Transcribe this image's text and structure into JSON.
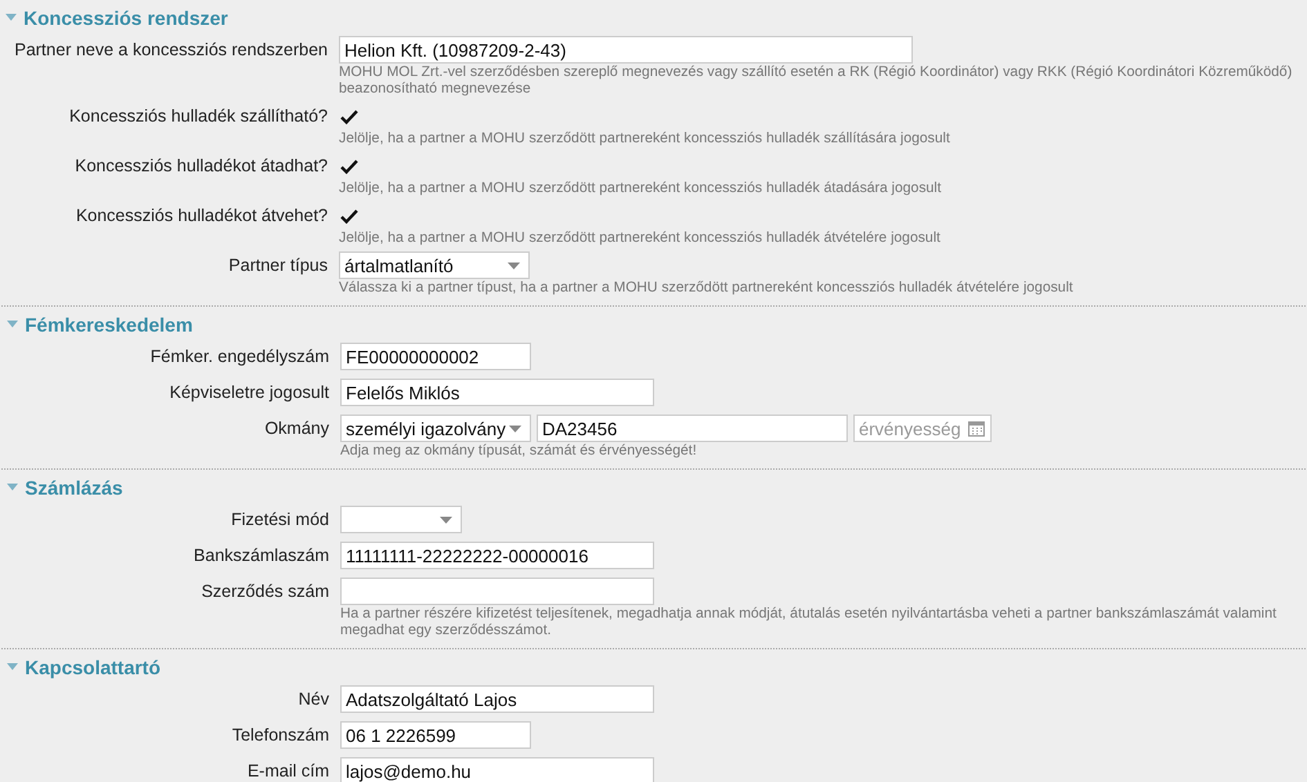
{
  "sections": [
    {
      "title": "Koncessziós rendszer",
      "expanded": true,
      "rows": [
        {
          "kind": "text",
          "label": "Partner neve a koncessziós rendszerben",
          "value": "Helion Kft. (10987209-2-43)",
          "help": "MOHU MOL Zrt.-vel szerződésben szereplő megnevezés vagy szállító esetén a RK (Régió Koordinátor) vagy RKK (Régió Koordinátori Közreműködő) beazonosítható megnevezése"
        },
        {
          "kind": "checkbox",
          "label": "Koncessziós hulladék szállítható?",
          "checked": true,
          "help": "Jelölje, ha a partner a MOHU szerződött partnereként koncessziós hulladék szállítására jogosult"
        },
        {
          "kind": "checkbox",
          "label": "Koncessziós hulladékot átadhat?",
          "checked": true,
          "help": "Jelölje, ha a partner a MOHU szerződött partnereként koncessziós hulladék átadására jogosult"
        },
        {
          "kind": "checkbox",
          "label": "Koncessziós hulladékot átvehet?",
          "checked": true,
          "help": "Jelölje, ha a partner a MOHU szerződött partnereként koncessziós hulladék átvételére jogosult"
        },
        {
          "kind": "select",
          "label": "Partner típus",
          "value": "ártalmatlanító",
          "help": "Válassza ki a partner típust, ha a partner a MOHU szerződött partnereként koncessziós hulladék átvételére jogosult"
        }
      ]
    },
    {
      "title": "Fémkereskedelem",
      "expanded": true,
      "rows": [
        {
          "kind": "text",
          "label": "Fémker. engedélyszám",
          "value": "FE00000000002"
        },
        {
          "kind": "text",
          "label": "Képviseletre jogosult",
          "value": "Felelős Miklós"
        },
        {
          "kind": "document",
          "label": "Okmány",
          "type": "személyi igazolvány",
          "number": "DA23456",
          "date_placeholder": "érvényesség",
          "help": "Adja meg az okmány típusát, számát és érvényességét!"
        }
      ]
    },
    {
      "title": "Számlázás",
      "expanded": true,
      "rows": [
        {
          "kind": "select",
          "label": "Fizetési mód"
        },
        {
          "kind": "text",
          "label": "Bankszámlaszám",
          "value": "11111111-22222222-00000016"
        },
        {
          "kind": "text",
          "label": "Szerződés szám",
          "help": "Ha a partner részére kifizetést teljesítenek, megadhatja annak módját, átutalás esetén nyilvántartásba veheti a partner bankszámlaszámát valamint megadhat egy szerződésszámot."
        }
      ]
    },
    {
      "title": "Kapcsolattartó",
      "expanded": true,
      "rows": [
        {
          "kind": "text",
          "label": "Név",
          "value": "Adatszolgáltató Lajos"
        },
        {
          "kind": "text",
          "label": "Telefonszám",
          "value": "06 1 2226599"
        },
        {
          "kind": "text",
          "label": "E-mail cím",
          "value": "lajos@demo.hu"
        }
      ]
    }
  ]
}
